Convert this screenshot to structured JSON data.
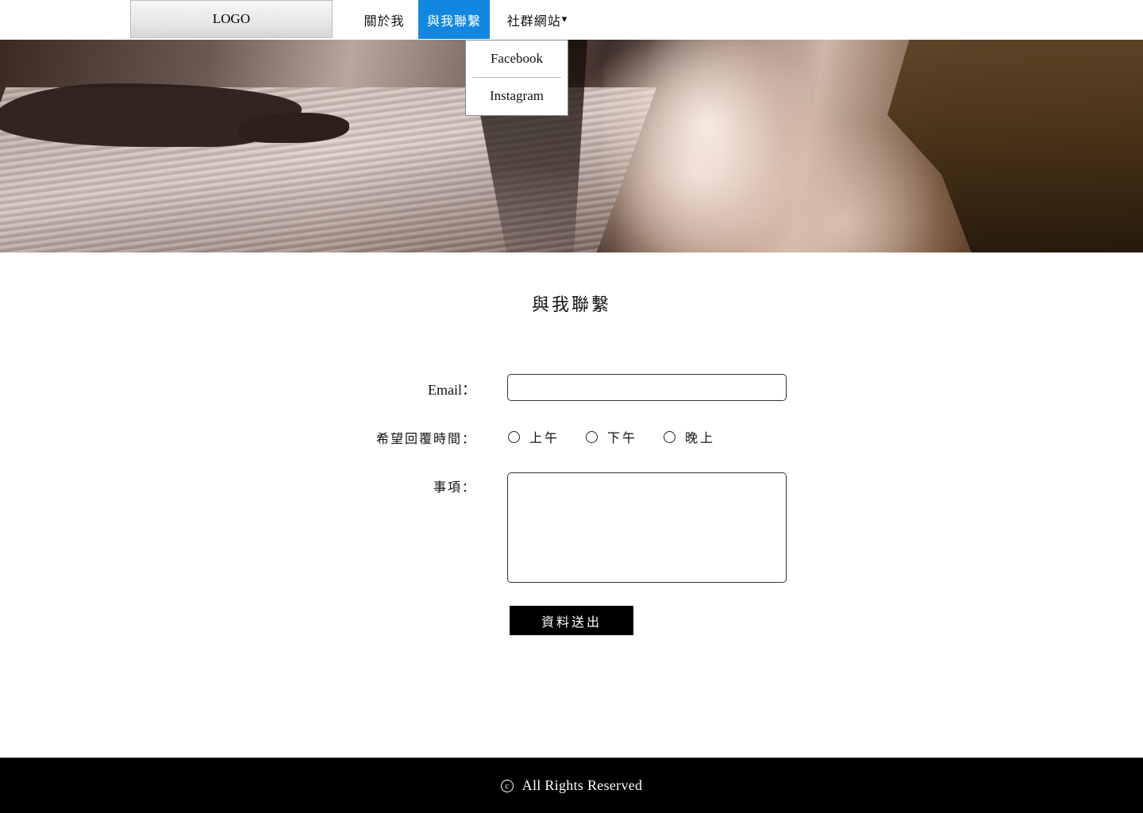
{
  "header": {
    "logo": "LOGO",
    "nav": {
      "about": "關於我",
      "contact": "與我聯繫",
      "social": "社群網站",
      "social_caret": "▾"
    },
    "active_color": "#1187df"
  },
  "dropdown": {
    "items": [
      {
        "label": "Facebook"
      },
      {
        "label": "Instagram"
      }
    ]
  },
  "main": {
    "title": "與我聯繫",
    "form": {
      "email_label": "Email：",
      "email_value": "",
      "time_label": "希望回覆時間：",
      "time_options": [
        {
          "label": "上午"
        },
        {
          "label": "下午"
        },
        {
          "label": "晚上"
        }
      ],
      "matter_label": "事項：",
      "matter_value": "",
      "submit_label": "資料送出"
    }
  },
  "footer": {
    "copyright_symbol": "c",
    "text": "All Rights Reserved"
  }
}
